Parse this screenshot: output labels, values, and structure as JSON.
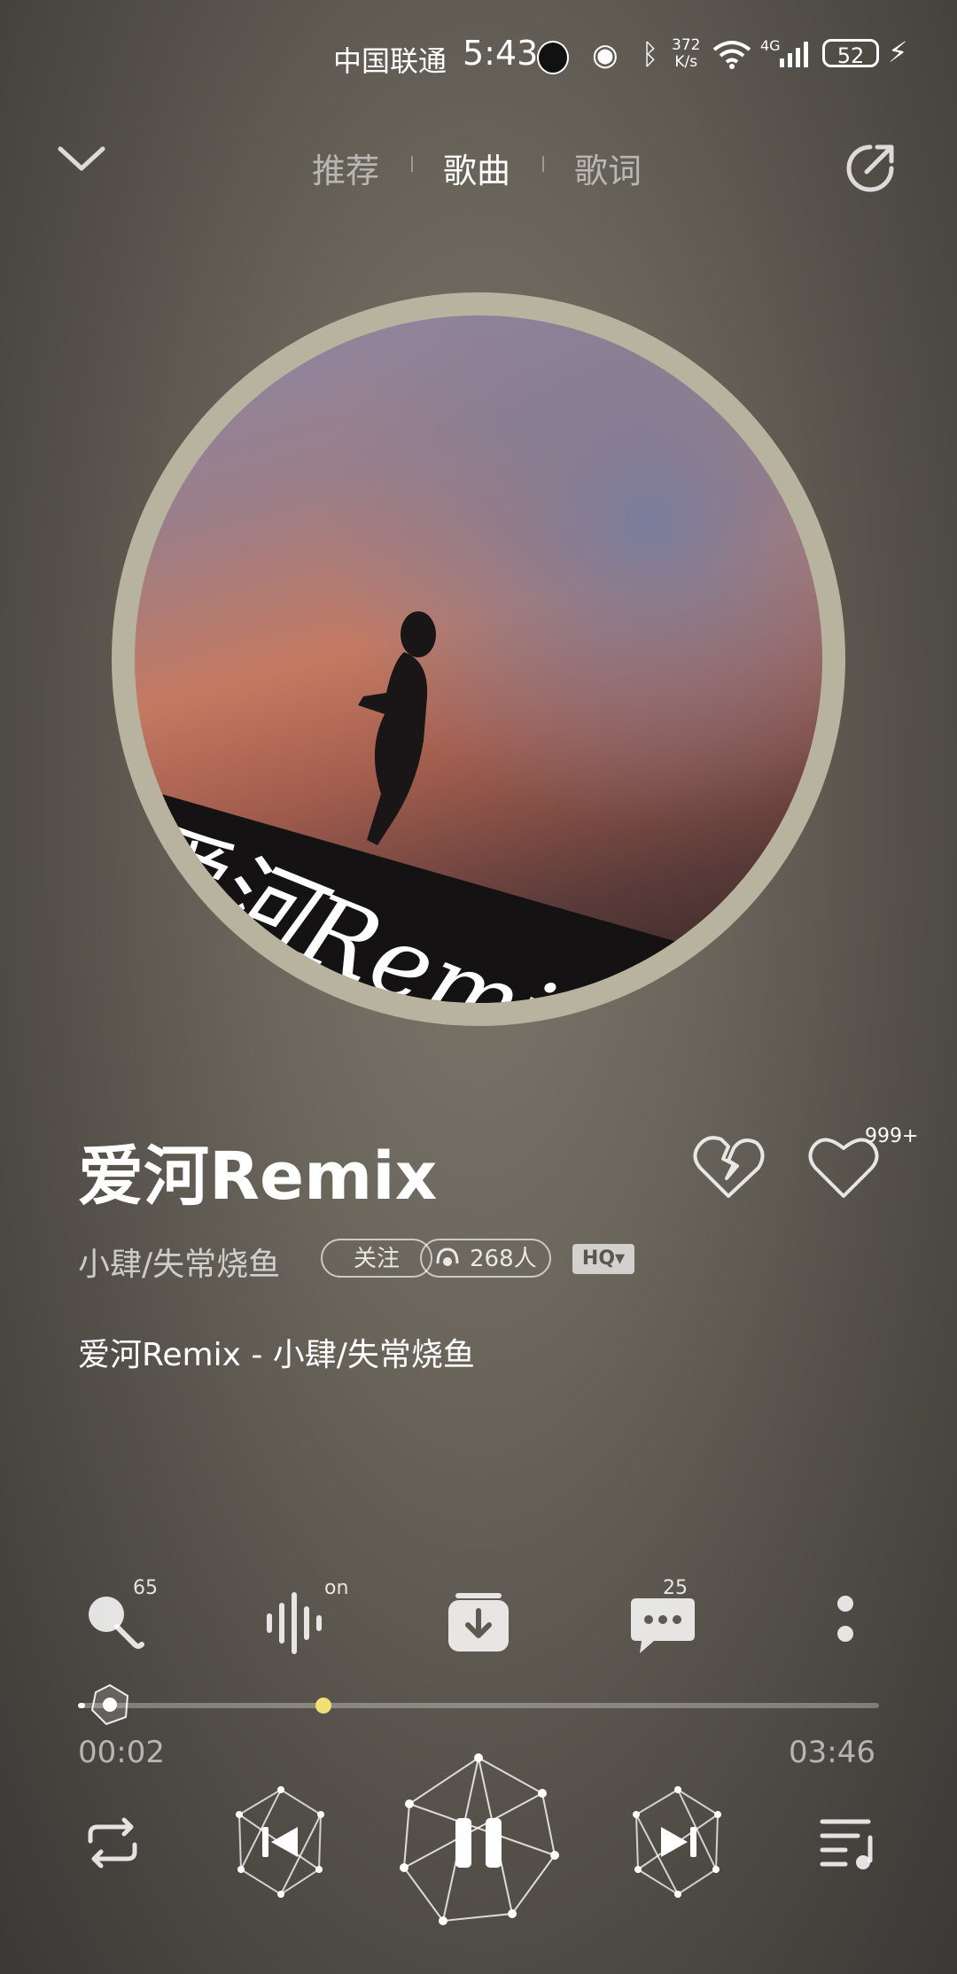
{
  "status_bar": {
    "carrier": "中国联通",
    "time": "5:43",
    "net_speed_value": "372",
    "net_speed_unit": "K/s",
    "network_type": "4G",
    "battery": "52"
  },
  "header": {
    "tabs": [
      {
        "label": "推荐",
        "active": false
      },
      {
        "label": "歌曲",
        "active": true
      },
      {
        "label": "歌词",
        "active": false
      }
    ]
  },
  "album": {
    "art_text": "爱河Remix"
  },
  "song": {
    "title": "爱河Remix",
    "artist": "小肆/失常烧鱼",
    "follow_label": "关注",
    "listeners": "268人",
    "quality": "HQ▾",
    "like_count": "999+",
    "lyric_line": "爱河Remix - 小肆/失常烧鱼"
  },
  "actions": {
    "karaoke_count": "65",
    "sound_effect_status": "on",
    "comment_count": "25"
  },
  "progress": {
    "current": "00:02",
    "total": "03:46",
    "fraction": 0.009
  },
  "colors": {
    "accent_marker": "#f2df74",
    "disc_ring": "#b8b39f"
  }
}
